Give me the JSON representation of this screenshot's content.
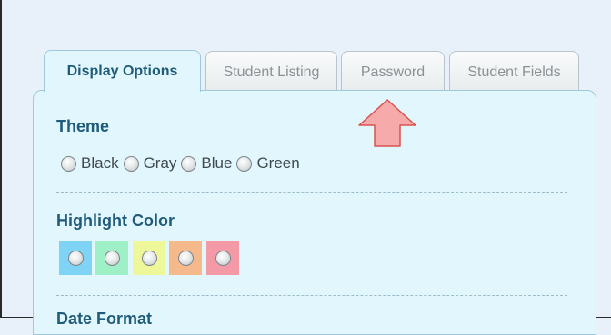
{
  "tabs": [
    {
      "label": "Display Options",
      "active": true
    },
    {
      "label": "Student Listing",
      "active": false
    },
    {
      "label": "Password",
      "active": false
    },
    {
      "label": "Student Fields",
      "active": false
    }
  ],
  "theme": {
    "title": "Theme",
    "options": [
      "Black",
      "Gray",
      "Blue",
      "Green"
    ]
  },
  "highlight": {
    "title": "Highlight Color",
    "colors": [
      "#7fd3f5",
      "#9ff0c6",
      "#eef79a",
      "#f6b98b",
      "#f39aa6"
    ]
  },
  "date_format": {
    "title": "Date Format"
  },
  "colors": {
    "accent_text": "#1f5b7a",
    "panel_bg": "#e2f7fd",
    "arrow_fill": "#f7aaaa",
    "arrow_stroke": "#d9534f"
  },
  "icons": {
    "arrow": "up-arrow-icon"
  }
}
